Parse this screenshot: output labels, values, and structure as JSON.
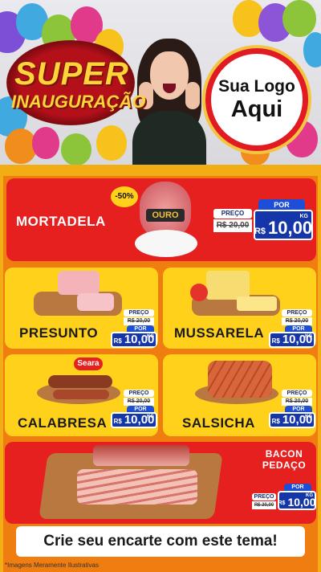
{
  "header": {
    "headline_1": "SUPER",
    "headline_2": "INAUGURAÇÃO",
    "logo_line_1": "Sua Logo",
    "logo_line_2": "Aqui"
  },
  "products": [
    {
      "name": "MORTADELA",
      "discount_badge": "-50%",
      "brand": "OURO",
      "preco_label": "PREÇO",
      "old_price": "R$ 20,00",
      "por_label": "POR",
      "currency": "R$",
      "price": "10,00",
      "unit": "KG"
    },
    {
      "name": "PRESUNTO",
      "preco_label": "PREÇO",
      "old_price": "R$ 20,00",
      "por_label": "POR",
      "currency": "R$",
      "price": "10,00",
      "unit": "KG"
    },
    {
      "name": "MUSSARELA",
      "preco_label": "PREÇO",
      "old_price": "R$ 20,00",
      "por_label": "POR",
      "currency": "R$",
      "price": "10,00",
      "unit": "KG"
    },
    {
      "name": "CALABRESA",
      "brand": "Seara",
      "preco_label": "PREÇO",
      "old_price": "R$ 20,00",
      "por_label": "POR",
      "currency": "R$",
      "price": "10,00",
      "unit": "KG"
    },
    {
      "name": "SALSICHA",
      "preco_label": "PREÇO",
      "old_price": "R$ 20,00",
      "por_label": "POR",
      "currency": "R$",
      "price": "10,00",
      "unit": "KG"
    },
    {
      "name_line_1": "BACON",
      "name_line_2": "PEDAÇO",
      "preco_label": "PREÇO",
      "old_price": "R$ 20,00",
      "por_label": "POR",
      "currency": "R$",
      "price": "10,00",
      "unit": "KG"
    }
  ],
  "footer": {
    "cta": "Crie seu encarte com este tema!",
    "disclaimer": "*Imagens Meramente Ilustrativas"
  },
  "colors": {
    "red_panel": "#e5201f",
    "yellow_panel": "#ffd11a",
    "price_blue": "#1536a8",
    "background_orange": "#f07d10"
  }
}
